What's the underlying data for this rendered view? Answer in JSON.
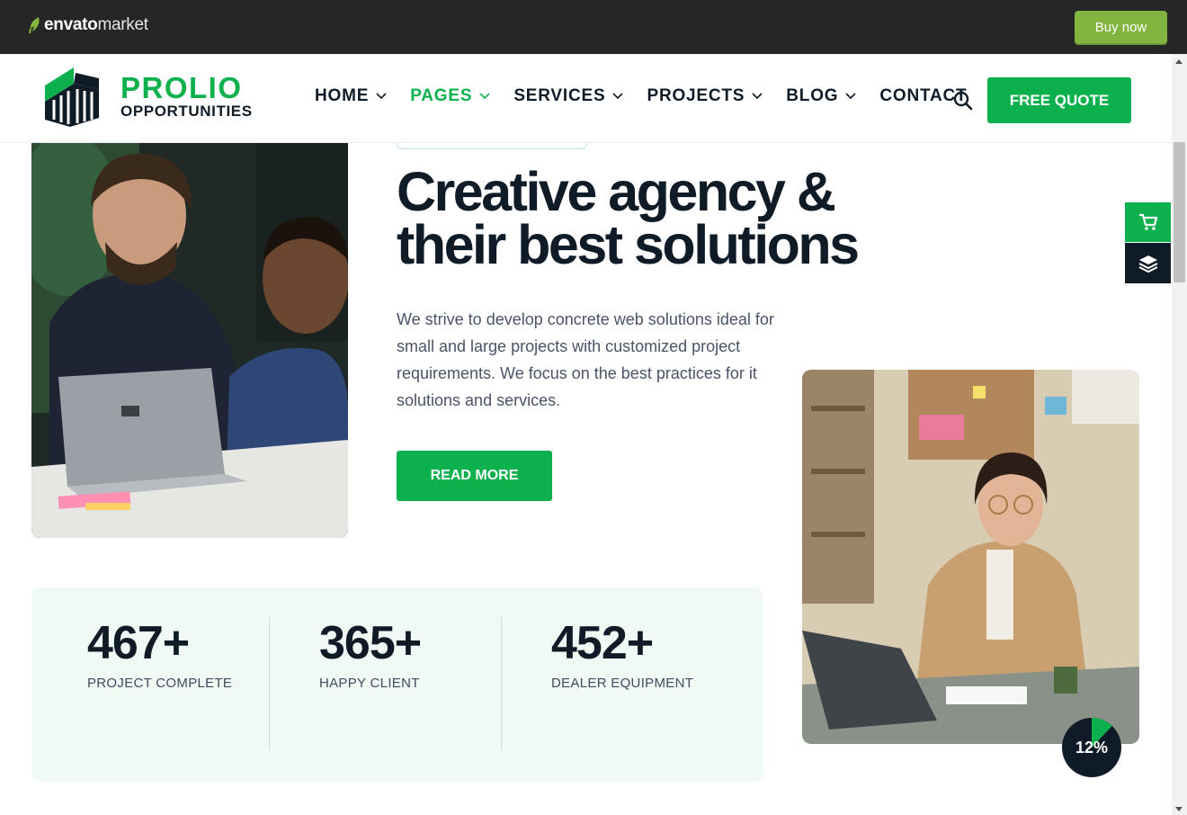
{
  "envato": {
    "brand": "envato",
    "market": "market",
    "buy_label": "Buy now"
  },
  "header": {
    "logo_title": "PROLIO",
    "logo_subtitle": "OPPORTUNITIES",
    "nav": [
      {
        "label": "HOME",
        "dropdown": true,
        "active": false
      },
      {
        "label": "PAGES",
        "dropdown": true,
        "active": true
      },
      {
        "label": "SERVICES",
        "dropdown": true,
        "active": false
      },
      {
        "label": "PROJECTS",
        "dropdown": true,
        "active": false
      },
      {
        "label": "BLOG",
        "dropdown": true,
        "active": false
      },
      {
        "label": "CONTACT",
        "dropdown": false,
        "active": false
      }
    ],
    "cta_label": "FREE QUOTE"
  },
  "hero": {
    "title_line1": "Creative agency &",
    "title_line2": "their best solutions",
    "description": "We strive to develop concrete web solutions ideal for small and large projects with customized project requirements. We focus on the best practices for it solutions and services.",
    "button_label": "READ MORE"
  },
  "stats": [
    {
      "number": "467+",
      "label": "PROJECT COMPLETE"
    },
    {
      "number": "365+",
      "label": "HAPPY CLIENT"
    },
    {
      "number": "452+",
      "label": "DEALER EQUIPMENT"
    }
  ],
  "scroll_progress": {
    "label": "12%",
    "value": 0.12
  },
  "colors": {
    "accent": "#0cb14d",
    "dark": "#0f1c27",
    "envato_green": "#82b440",
    "stats_bg": "#f1f9f5"
  },
  "icons": {
    "search": "search-icon",
    "cart": "cart-icon",
    "layers": "layers-icon",
    "chevron": "chevron-down-icon"
  }
}
